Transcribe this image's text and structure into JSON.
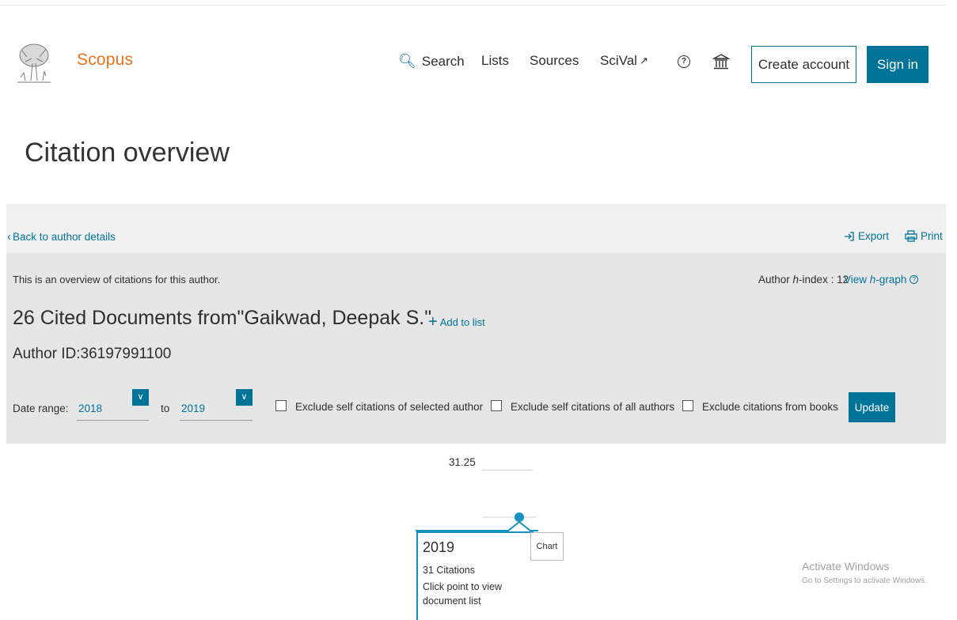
{
  "header": {
    "brand": "Scopus",
    "nav": {
      "search": "Search",
      "lists": "Lists",
      "sources": "Sources",
      "scival": "SciVal"
    },
    "help_icon_glyph": "?",
    "create_account": "Create account",
    "sign_in": "Sign in"
  },
  "page": {
    "title": "Citation overview"
  },
  "toolbar": {
    "back": "Back to author details",
    "export": "Export",
    "print": "Print"
  },
  "overview": {
    "intro": "This is an overview of citations for this author.",
    "hindex_prefix": "Author ",
    "hindex_h": "h",
    "hindex_suffix": "-index : 12",
    "view_prefix": "View ",
    "view_h": "h",
    "view_suffix": "-graph",
    "docs_title": "26 Cited Documents from\"Gaikwad, Deepak S.\"",
    "add_to_list": "Add to list",
    "author_id": "Author ID:36197991100"
  },
  "filters": {
    "date_range_label": "Date range:",
    "from_value": "2018",
    "to_label": "to",
    "to_value": "2019",
    "exclude_self_selected": "Exclude self citations of selected author",
    "exclude_self_all": "Exclude self citations of all authors",
    "exclude_books": "Exclude citations from books",
    "update": "Update"
  },
  "chart": {
    "y_tick": "31.25",
    "tooltip": {
      "year": "2019",
      "citations": "31 Citations",
      "hint": "Click point to view document list"
    },
    "tag": "Chart"
  },
  "chart_data": {
    "type": "line",
    "x": [
      "2019"
    ],
    "values": [
      31
    ],
    "y_ticks": [
      31.25
    ]
  },
  "watermark": {
    "title": "Activate Windows",
    "subtitle": "Go to Settings to activate Windows."
  },
  "colors": {
    "brand_orange": "#e9711c",
    "accent_blue": "#007398",
    "chart_blue": "#1a8fc4",
    "band_gray": "#e6e6e6"
  }
}
